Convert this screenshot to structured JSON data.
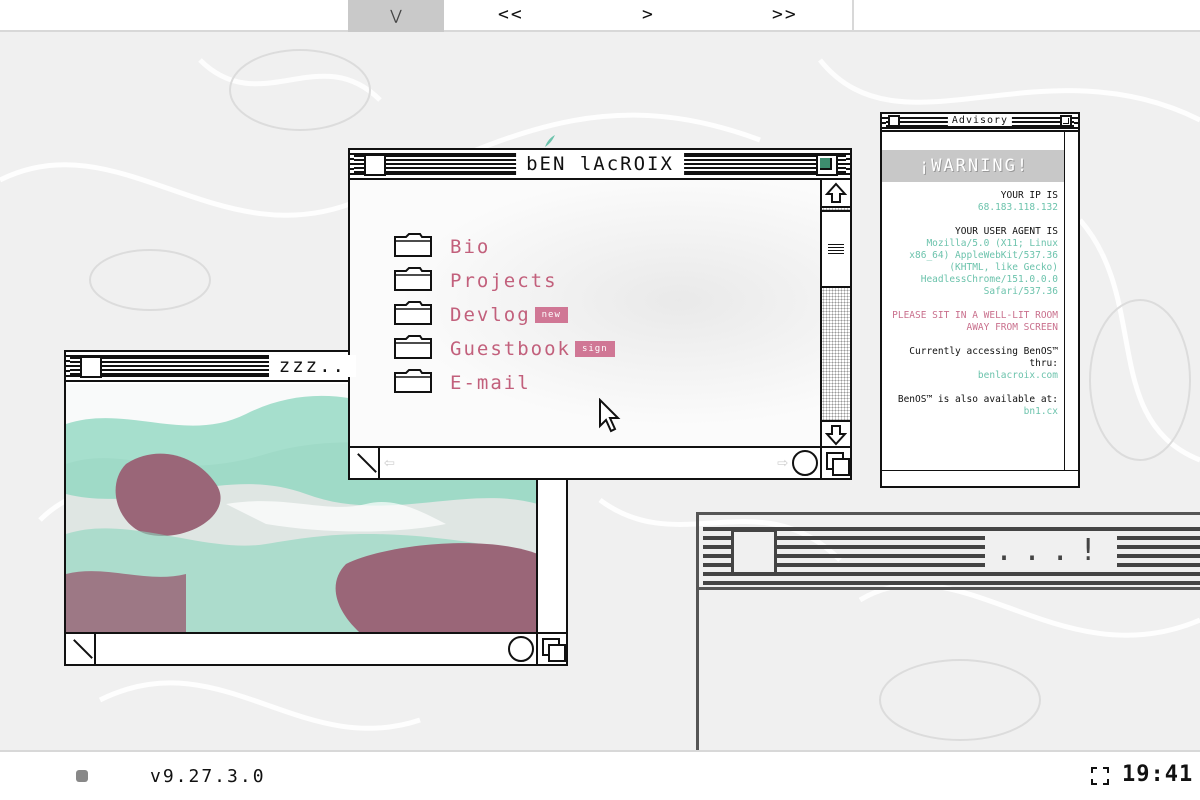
{
  "topbar": {
    "thumb_icon": "chevron-down-icon",
    "prev_label": "<<",
    "play_label": ">",
    "next_label": ">>"
  },
  "main_window": {
    "title": "bEN lAcROIX",
    "items": [
      {
        "label": "Bio",
        "badge": ""
      },
      {
        "label": "Projects",
        "badge": ""
      },
      {
        "label": "Devlog",
        "badge": "new"
      },
      {
        "label": "Guestbook",
        "badge": "sign"
      },
      {
        "label": "E-mail",
        "badge": ""
      }
    ]
  },
  "image_window": {
    "title": "zzz.."
  },
  "advisory": {
    "title": "Advisory",
    "warning": "¡WARNING!",
    "ip_label": "YOUR IP IS",
    "ip_value": "68.183.118.132",
    "ua_label": "YOUR USER AGENT IS",
    "ua_value": "Mozilla/5.0 (X11; Linux x86_64) AppleWebKit/537.36 (KHTML, like Gecko) HeadlessChrome/151.0.0.0 Safari/537.36",
    "notice": "PLEASE SIT IN A WELL-LIT ROOM AWAY FROM SCREEN",
    "access_label": "Currently accessing BenOS™ thru:",
    "access_value": "benlacroix.com",
    "also_label": "BenOS™ is also available at:",
    "also_value": "bn1.cx"
  },
  "lower_window": {
    "title": "...!"
  },
  "bottombar": {
    "version": "v9.27.3.0",
    "clock": "19:41"
  },
  "colors": {
    "accent_pink": "#c2607c",
    "accent_teal": "#6cc3ac",
    "window_border": "#111111",
    "background": "#f0f0f0"
  }
}
